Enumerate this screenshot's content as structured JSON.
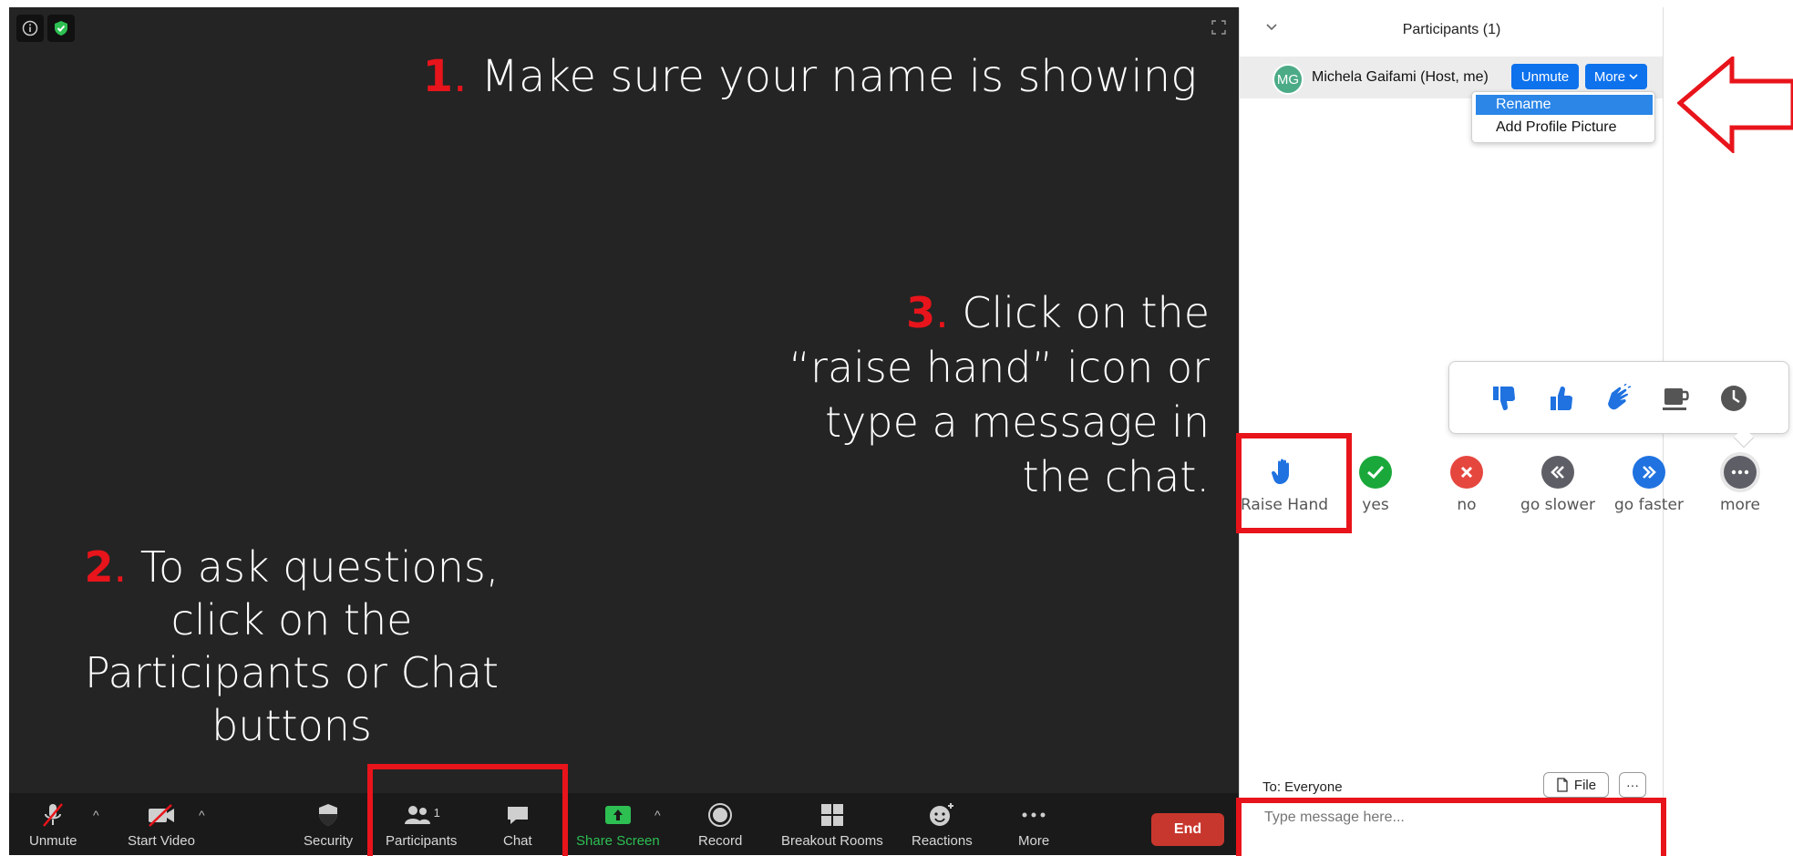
{
  "annotations": {
    "step1": {
      "num": "1",
      "dot": ".",
      "text": " Make sure your name is showing"
    },
    "step2": {
      "num": "2",
      "dot": ".",
      "line1": " To ask questions,",
      "line2": "click on the",
      "line3": "Participants or Chat",
      "line4": "buttons"
    },
    "step3": {
      "num": "3",
      "dot": ".",
      "line1": " Click on the",
      "line2": "“raise hand” icon or",
      "line3": "type a message in",
      "line4": "the chat."
    }
  },
  "toolbar": {
    "unmute": "Unmute",
    "start_video": "Start Video",
    "security": "Security",
    "participants": "Participants",
    "participants_count": "1",
    "chat": "Chat",
    "share_screen": "Share Screen",
    "record": "Record",
    "breakout_rooms": "Breakout Rooms",
    "reactions": "Reactions",
    "more": "More",
    "end": "End"
  },
  "participants_panel": {
    "title": "Participants (1)",
    "participant": {
      "initials": "MG",
      "name": "Michela Gaifami (Host, me)",
      "unmute_label": "Unmute",
      "more_label": "More"
    },
    "menu": {
      "rename": "Rename",
      "add_profile_picture": "Add Profile Picture"
    }
  },
  "feedback": {
    "raise_hand": "Raise Hand",
    "yes": "yes",
    "no": "no",
    "go_slower": "go slower",
    "go_faster": "go faster",
    "more": "more"
  },
  "chat": {
    "to": "To: Everyone",
    "file": "File",
    "more_dots": "···",
    "placeholder": "Type message here..."
  },
  "colors": {
    "accent_red": "#e8141b",
    "zoom_blue": "#0e72ed",
    "share_green": "#2dbf52",
    "meeting_bg": "#242424",
    "toolbar_bg": "#1a1a1a",
    "end_red": "#c8372d"
  },
  "icons": [
    "info-icon",
    "shield-check-icon",
    "fullscreen-icon",
    "microphone-muted-icon",
    "video-muted-icon",
    "shield-icon",
    "participants-icon",
    "chat-icon",
    "share-screen-icon",
    "record-icon",
    "breakout-rooms-icon",
    "reactions-icon",
    "more-dots-icon",
    "thumbs-down-icon",
    "thumbs-up-icon",
    "clap-icon",
    "coffee-icon",
    "clock-icon",
    "raise-hand-icon",
    "check-icon",
    "x-icon",
    "rewind-icon",
    "fast-forward-icon",
    "more-icon",
    "file-icon",
    "arrow-icon"
  ]
}
